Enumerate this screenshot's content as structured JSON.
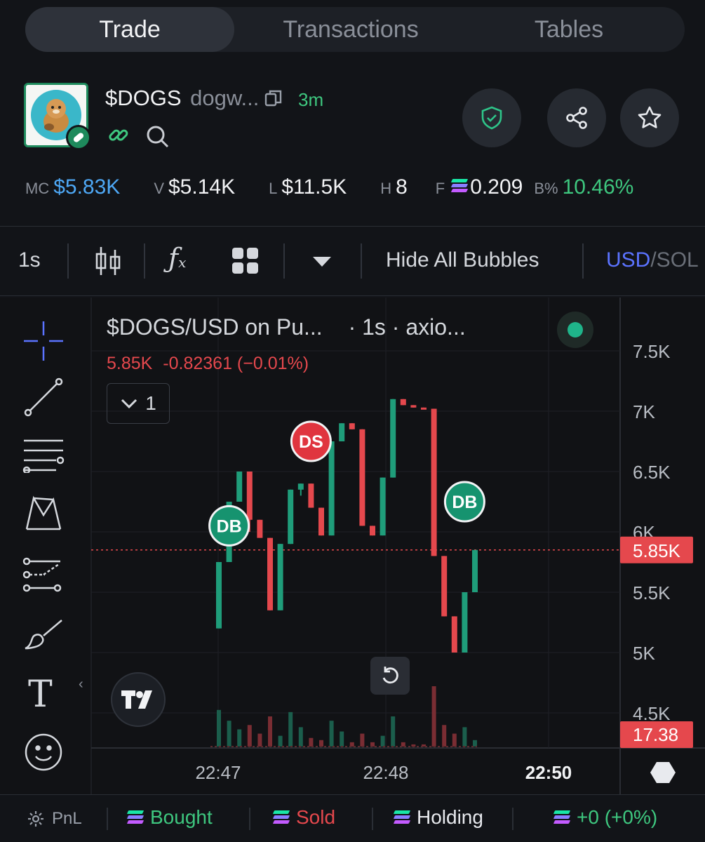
{
  "tabs": {
    "trade": "Trade",
    "transactions": "Transactions",
    "tables": "Tables"
  },
  "token": {
    "symbol": "$DOGS",
    "name_short": "dogw...",
    "age": "3m"
  },
  "stats": {
    "mc_label": "MC",
    "mc_value": "$5.83K",
    "v_label": "V",
    "v_value": "$5.14K",
    "l_label": "L",
    "l_value": "$11.5K",
    "h_label": "H",
    "h_value": "8",
    "f_label": "F",
    "f_value": "0.209",
    "b_label": "B%",
    "b_value": "10.46%"
  },
  "toolbar": {
    "interval": "1s",
    "hide_bubbles": "Hide All Bubbles",
    "usd": "USD",
    "sol": "/SOL"
  },
  "legend": {
    "title": "$DOGS/USD on Pu...",
    "sub": "· 1s · axio...",
    "last": "5.85K",
    "change": "-0.82361 (−0.01%)",
    "collapse_count": "1"
  },
  "colors": {
    "up": "#1f9d7a",
    "down": "#e5484d",
    "accent_blue": "#4ea8f5",
    "green_text": "#3ec77f",
    "usd_blue": "#5b73ff"
  },
  "chart_data": {
    "type": "candlestick",
    "yticks": [
      "7.5K",
      "7K",
      "6.5K",
      "6K",
      "5.5K",
      "5K",
      "4.5K"
    ],
    "ylim": [
      4.3,
      7.8
    ],
    "xticks": [
      "22:47",
      "22:48",
      "22:50"
    ],
    "price_label": "5.85K",
    "volume_label": "17.38",
    "candles": [
      {
        "o": 5.2,
        "h": 5.75,
        "l": 5.2,
        "c": 5.75
      },
      {
        "o": 5.75,
        "h": 6.25,
        "l": 5.75,
        "c": 6.25
      },
      {
        "o": 6.25,
        "h": 6.5,
        "l": 6.25,
        "c": 6.5
      },
      {
        "o": 6.5,
        "h": 6.5,
        "l": 6.0,
        "c": 6.1
      },
      {
        "o": 6.1,
        "h": 6.1,
        "l": 5.95,
        "c": 5.95
      },
      {
        "o": 5.95,
        "h": 5.95,
        "l": 5.35,
        "c": 5.35
      },
      {
        "o": 5.35,
        "h": 5.9,
        "l": 5.35,
        "c": 5.9
      },
      {
        "o": 5.9,
        "h": 6.35,
        "l": 5.9,
        "c": 6.35
      },
      {
        "o": 6.35,
        "h": 6.4,
        "l": 6.3,
        "c": 6.4
      },
      {
        "o": 6.4,
        "h": 6.4,
        "l": 6.2,
        "c": 6.2
      },
      {
        "o": 6.2,
        "h": 6.2,
        "l": 5.97,
        "c": 5.97
      },
      {
        "o": 5.97,
        "h": 6.75,
        "l": 5.97,
        "c": 6.75
      },
      {
        "o": 6.75,
        "h": 6.9,
        "l": 6.75,
        "c": 6.9
      },
      {
        "o": 6.9,
        "h": 6.9,
        "l": 6.85,
        "c": 6.85
      },
      {
        "o": 6.85,
        "h": 6.85,
        "l": 6.05,
        "c": 6.05
      },
      {
        "o": 6.05,
        "h": 6.05,
        "l": 5.97,
        "c": 5.97
      },
      {
        "o": 5.97,
        "h": 6.45,
        "l": 5.97,
        "c": 6.45
      },
      {
        "o": 6.45,
        "h": 7.1,
        "l": 6.45,
        "c": 7.1
      },
      {
        "o": 7.1,
        "h": 7.1,
        "l": 7.05,
        "c": 7.05
      },
      {
        "o": 7.05,
        "h": 7.05,
        "l": 7.03,
        "c": 7.03
      },
      {
        "o": 7.03,
        "h": 7.03,
        "l": 7.02,
        "c": 7.02
      },
      {
        "o": 7.02,
        "h": 7.02,
        "l": 5.8,
        "c": 5.8
      },
      {
        "o": 5.8,
        "h": 5.8,
        "l": 5.3,
        "c": 5.3
      },
      {
        "o": 5.3,
        "h": 5.3,
        "l": 5.0,
        "c": 5.0
      },
      {
        "o": 5.0,
        "h": 5.5,
        "l": 5.0,
        "c": 5.5
      },
      {
        "o": 5.5,
        "h": 5.85,
        "l": 5.5,
        "c": 5.85
      }
    ],
    "volumes": [
      17,
      12,
      8,
      10,
      6,
      14,
      5,
      16,
      9,
      4,
      3,
      12,
      7,
      2,
      6,
      2,
      5,
      14,
      2,
      1,
      1,
      28,
      10,
      6,
      9,
      3
    ],
    "markers": [
      {
        "label": "DB",
        "candle": 1,
        "price": 6.05,
        "side": "buy"
      },
      {
        "label": "DS",
        "candle": 9,
        "price": 6.75,
        "side": "sell"
      },
      {
        "label": "DB",
        "candle": 24,
        "price": 6.25,
        "side": "buy"
      }
    ]
  },
  "bottom": {
    "pnl": "PnL",
    "bought": "Bought",
    "sold": "Sold",
    "holding": "Holding",
    "total": "+0 (+0%)"
  }
}
